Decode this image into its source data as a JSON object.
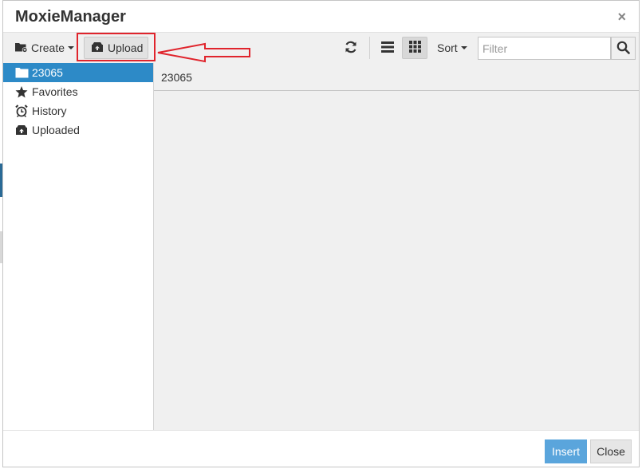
{
  "window": {
    "title": "MoxieManager",
    "close_glyph": "×"
  },
  "toolbar": {
    "create_label": "Create",
    "upload_label": "Upload",
    "sort_label": "Sort",
    "filter_placeholder": "Filter"
  },
  "sidebar": {
    "items": [
      {
        "label": "23065",
        "icon": "folder-icon",
        "active": true
      },
      {
        "label": "Favorites",
        "icon": "star-icon",
        "active": false
      },
      {
        "label": "History",
        "icon": "alarm-clock-icon",
        "active": false
      },
      {
        "label": "Uploaded",
        "icon": "upload-box-icon",
        "active": false
      }
    ]
  },
  "main": {
    "path": "23065"
  },
  "footer": {
    "insert_label": "Insert",
    "close_label": "Close"
  },
  "colors": {
    "accent": "#2d8ac7",
    "insert_button": "#5aa5dc",
    "highlight": "#e0242c"
  }
}
